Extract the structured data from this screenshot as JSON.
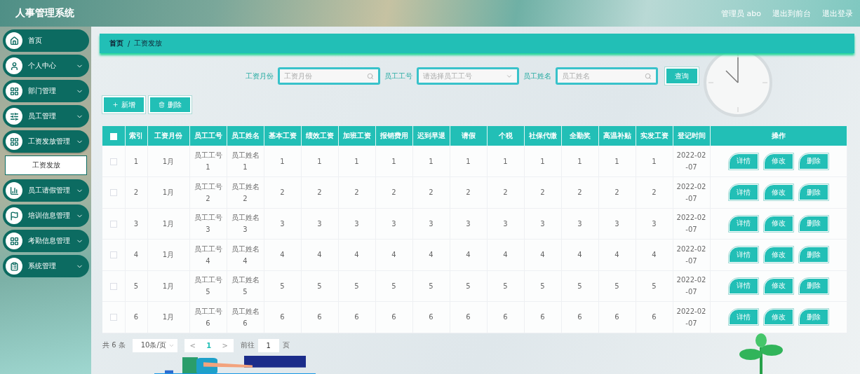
{
  "header": {
    "title": "人事管理系统",
    "user": "管理员 abo",
    "links": [
      "退出到前台",
      "退出登录"
    ]
  },
  "sidebar": {
    "items": [
      {
        "label": "首页",
        "kind": "link"
      },
      {
        "label": "个人中心",
        "kind": "group"
      },
      {
        "label": "部门管理",
        "kind": "group"
      },
      {
        "label": "员工管理",
        "kind": "group"
      },
      {
        "label": "工资发放管理",
        "kind": "group",
        "expanded": true,
        "children": [
          {
            "label": "工资发放",
            "selected": true
          }
        ]
      },
      {
        "label": "员工请假管理",
        "kind": "group"
      },
      {
        "label": "培训信息管理",
        "kind": "group"
      },
      {
        "label": "考勤信息管理",
        "kind": "group"
      },
      {
        "label": "系统管理",
        "kind": "group"
      }
    ]
  },
  "breadcrumb": [
    "首页",
    "/",
    "工资发放"
  ],
  "search": {
    "fields": [
      {
        "label": "工资月份",
        "placeholder": "工资月份",
        "kind": "text"
      },
      {
        "label": "员工工号",
        "placeholder": "请选择员工工号",
        "kind": "select"
      },
      {
        "label": "员工姓名",
        "placeholder": "员工姓名",
        "kind": "text"
      }
    ],
    "button": "查询"
  },
  "toolbar": [
    {
      "label": "新增",
      "kind": "add"
    },
    {
      "label": "删除",
      "kind": "delete"
    }
  ],
  "table": {
    "header_checked": false,
    "columns": [
      "索引",
      "工资月份",
      "员工工号",
      "员工姓名",
      "基本工资",
      "绩效工资",
      "加班工资",
      "报销费用",
      "迟到早退",
      "请假",
      "个税",
      "社保代缴",
      "全勤奖",
      "高温补贴",
      "实发工资",
      "登记时间",
      "操作"
    ],
    "rows": [
      {
        "checked": false,
        "cells": [
          "1",
          "1月",
          "员工工号1",
          "员工姓名1",
          "1",
          "1",
          "1",
          "1",
          "1",
          "1",
          "1",
          "1",
          "1",
          "1",
          "1",
          "2022-02-07"
        ],
        "actions": [
          "详情",
          "修改",
          "删除"
        ]
      },
      {
        "checked": false,
        "cells": [
          "2",
          "1月",
          "员工工号2",
          "员工姓名2",
          "2",
          "2",
          "2",
          "2",
          "2",
          "2",
          "2",
          "2",
          "2",
          "2",
          "2",
          "2022-02-07"
        ],
        "actions": [
          "详情",
          "修改",
          "删除"
        ]
      },
      {
        "checked": false,
        "cells": [
          "3",
          "1月",
          "员工工号3",
          "员工姓名3",
          "3",
          "3",
          "3",
          "3",
          "3",
          "3",
          "3",
          "3",
          "3",
          "3",
          "3",
          "2022-02-07"
        ],
        "actions": [
          "详情",
          "修改",
          "删除"
        ]
      },
      {
        "checked": false,
        "cells": [
          "4",
          "1月",
          "员工工号4",
          "员工姓名4",
          "4",
          "4",
          "4",
          "4",
          "4",
          "4",
          "4",
          "4",
          "4",
          "4",
          "4",
          "2022-02-07"
        ],
        "actions": [
          "详情",
          "修改",
          "删除"
        ]
      },
      {
        "checked": false,
        "cells": [
          "5",
          "1月",
          "员工工号5",
          "员工姓名5",
          "5",
          "5",
          "5",
          "5",
          "5",
          "5",
          "5",
          "5",
          "5",
          "5",
          "5",
          "2022-02-07"
        ],
        "actions": [
          "详情",
          "修改",
          "删除"
        ]
      },
      {
        "checked": false,
        "cells": [
          "6",
          "1月",
          "员工工号6",
          "员工姓名6",
          "6",
          "6",
          "6",
          "6",
          "6",
          "6",
          "6",
          "6",
          "6",
          "6",
          "6",
          "2022-02-07"
        ],
        "actions": [
          "详情",
          "修改",
          "删除"
        ]
      }
    ]
  },
  "pagination": {
    "total": "共 6 条",
    "page_size": "10条/页",
    "prev": "<",
    "current": "1",
    "next": ">",
    "goto": "前往",
    "goto_value": "1",
    "page_suffix": "页"
  }
}
